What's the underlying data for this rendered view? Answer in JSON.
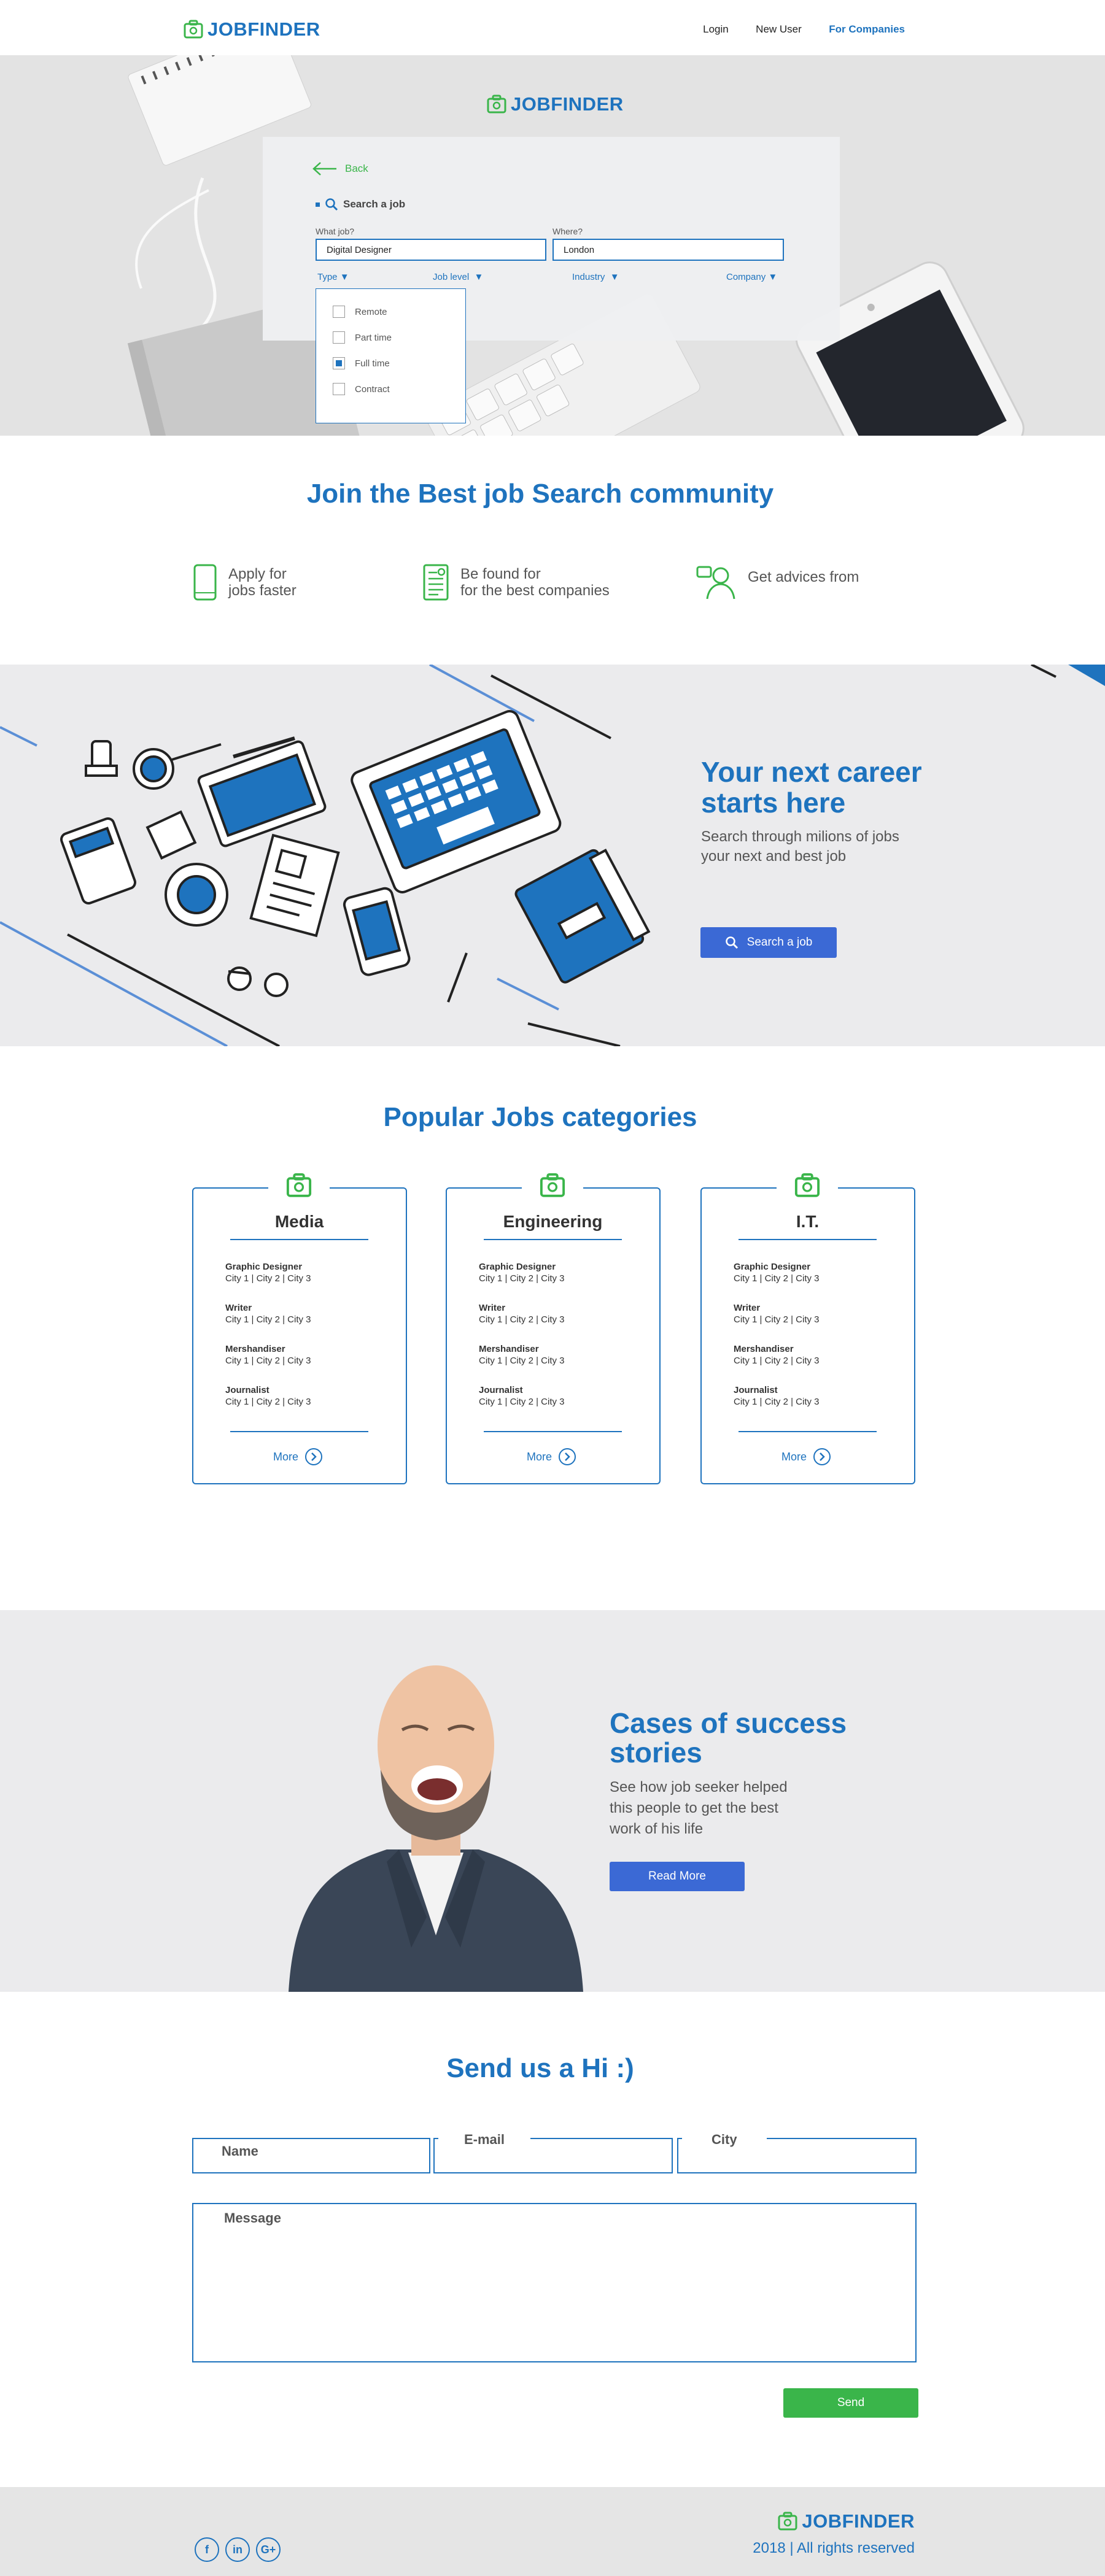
{
  "brand": {
    "name": "JOBFINDER",
    "accent": "#1e73be",
    "green": "#3ab54a"
  },
  "nav": {
    "login": "Login",
    "new_user": "New User",
    "for_companies": "For Companies"
  },
  "search": {
    "back": "Back",
    "title": "Search a job",
    "what_label": "What job?",
    "what_value": "Digital Designer",
    "where_label": "Where?",
    "where_value": "London",
    "filters": [
      "Type",
      "Job level",
      "Industry",
      "Company"
    ],
    "type_options": [
      {
        "label": "Remote",
        "checked": false
      },
      {
        "label": "Part time",
        "checked": false
      },
      {
        "label": "Full time",
        "checked": true
      },
      {
        "label": "Contract",
        "checked": false
      }
    ]
  },
  "community": {
    "title": "Join the Best job Search community",
    "features": [
      {
        "icon": "phone-icon",
        "line1": "Apply for",
        "line2": "jobs faster"
      },
      {
        "icon": "document-icon",
        "line1": "Be found for",
        "line2": "for the best companies"
      },
      {
        "icon": "advisor-icon",
        "line1": "Get advices from",
        "line2": ""
      }
    ]
  },
  "career": {
    "title1": "Your next career",
    "title2": "starts here",
    "text1": "Search through milions of jobs",
    "text2": "your next and best job",
    "button": "Search a job"
  },
  "categories": {
    "title": "Popular Jobs categories",
    "more": "More",
    "cards": [
      {
        "name": "Media",
        "jobs": [
          {
            "title": "Graphic Designer",
            "cities": "City 1 | City 2 | City 3"
          },
          {
            "title": "Writer",
            "cities": "City 1 | City 2 | City 3"
          },
          {
            "title": "Mershandiser",
            "cities": "City 1 | City 2 | City 3"
          },
          {
            "title": "Journalist",
            "cities": "City 1 | City 2 | City 3"
          }
        ]
      },
      {
        "name": "Engineering",
        "jobs": [
          {
            "title": "Graphic Designer",
            "cities": "City 1 | City 2 | City 3"
          },
          {
            "title": "Writer",
            "cities": "City 1 | City 2 | City 3"
          },
          {
            "title": "Mershandiser",
            "cities": "City 1 | City 2 | City 3"
          },
          {
            "title": "Journalist",
            "cities": "City 1 | City 2 | City 3"
          }
        ]
      },
      {
        "name": "I.T.",
        "jobs": [
          {
            "title": "Graphic Designer",
            "cities": "City 1 | City 2 | City 3"
          },
          {
            "title": "Writer",
            "cities": "City 1 | City 2 | City 3"
          },
          {
            "title": "Mershandiser",
            "cities": "City 1 | City 2 | City 3"
          },
          {
            "title": "Journalist",
            "cities": "City 1 | City 2 | City 3"
          }
        ]
      }
    ]
  },
  "success": {
    "title1": "Cases of success",
    "title2": "stories",
    "text1": "See how job seeker helped",
    "text2": "this people to get the best",
    "text3": "work of his life",
    "button": "Read More"
  },
  "contact": {
    "title": "Send us a Hi :)",
    "name": "Name",
    "email": "E-mail",
    "city": "City",
    "message": "Message",
    "send": "Send"
  },
  "footer": {
    "copyright": "2018 | All rights reserved",
    "social": [
      "f",
      "in",
      "G+"
    ]
  }
}
